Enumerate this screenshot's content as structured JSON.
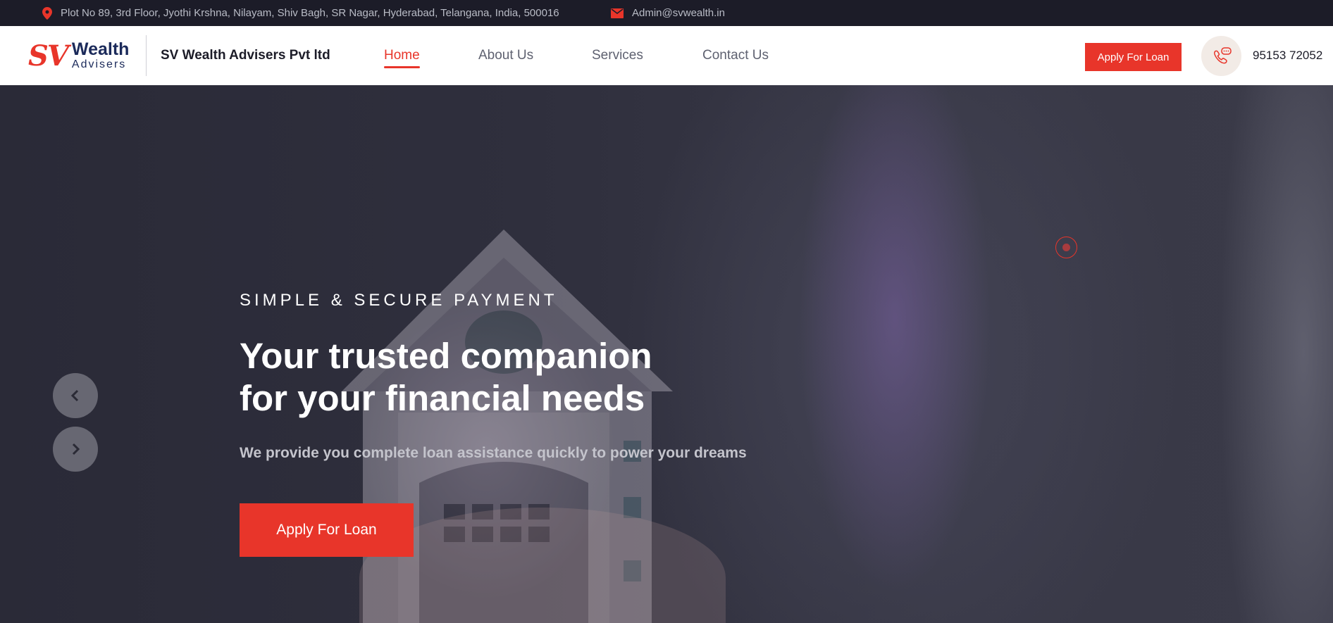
{
  "topbar": {
    "address": "Plot No 89, 3rd Floor, Jyothi Krshna, Nilayam, Shiv Bagh, SR Nagar, Hyderabad, Telangana, India, 500016",
    "email": "Admin@svwealth.in",
    "icons": {
      "address": "map-pin-icon",
      "email": "mail-icon"
    }
  },
  "header": {
    "logo": {
      "mark": "SV",
      "line1": "Wealth",
      "line2": "Advisers"
    },
    "company_name": "SV Wealth Advisers Pvt ltd",
    "nav": [
      {
        "label": "Home",
        "active": true
      },
      {
        "label": "About Us",
        "active": false
      },
      {
        "label": "Services",
        "active": false
      },
      {
        "label": "Contact Us",
        "active": false
      }
    ],
    "apply_button": "Apply For Loan",
    "phone": "95153 72052",
    "phone_icon": "phone-chat-icon"
  },
  "hero": {
    "eyebrow": "SIMPLE & SECURE PAYMENT",
    "headline_line1": "Your trusted companion",
    "headline_line2": "for your financial needs",
    "subtext": "We provide you complete loan assistance quickly to power your dreams",
    "cta": "Apply For Loan",
    "prev_icon": "chevron-left-icon",
    "next_icon": "chevron-right-icon"
  },
  "colors": {
    "accent": "#e8352a",
    "topbar_bg": "#1c1c28",
    "header_bg": "#ffffff",
    "brand_navy": "#1b2a5a"
  }
}
